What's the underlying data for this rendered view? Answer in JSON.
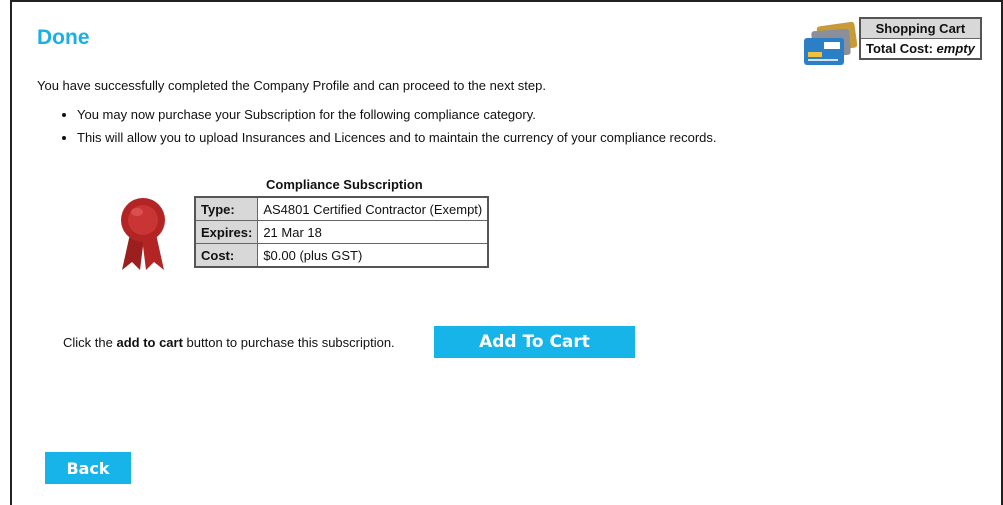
{
  "page": {
    "title": "Done"
  },
  "intro_text": "You have successfully completed the Company Profile and can proceed to the next step.",
  "bullets": [
    "You may now purchase your Subscription for the following compliance category.",
    "This will allow you to upload Insurances and Licences and to maintain the currency of your compliance records."
  ],
  "cart": {
    "heading": "Shopping Cart",
    "total_label": "Total Cost:",
    "total_value": "empty",
    "icon": "credit-cards-icon"
  },
  "subscription": {
    "caption": "Compliance Subscription",
    "seal_icon": "award-seal-icon",
    "rows": [
      {
        "label": "Type:",
        "value": "AS4801 Certified Contractor (Exempt)"
      },
      {
        "label": "Expires:",
        "value": "21 Mar 18"
      },
      {
        "label": "Cost:",
        "value": "$0.00 (plus GST)"
      }
    ]
  },
  "cta": {
    "text_before": "Click the ",
    "text_bold": "add to cart",
    "text_after": " button to purchase this subscription.",
    "add_button": "Add To Cart"
  },
  "back_button": "Back",
  "colors": {
    "accent": "#16b4e8",
    "title": "#1ab0e6",
    "seal": "#b32424"
  }
}
